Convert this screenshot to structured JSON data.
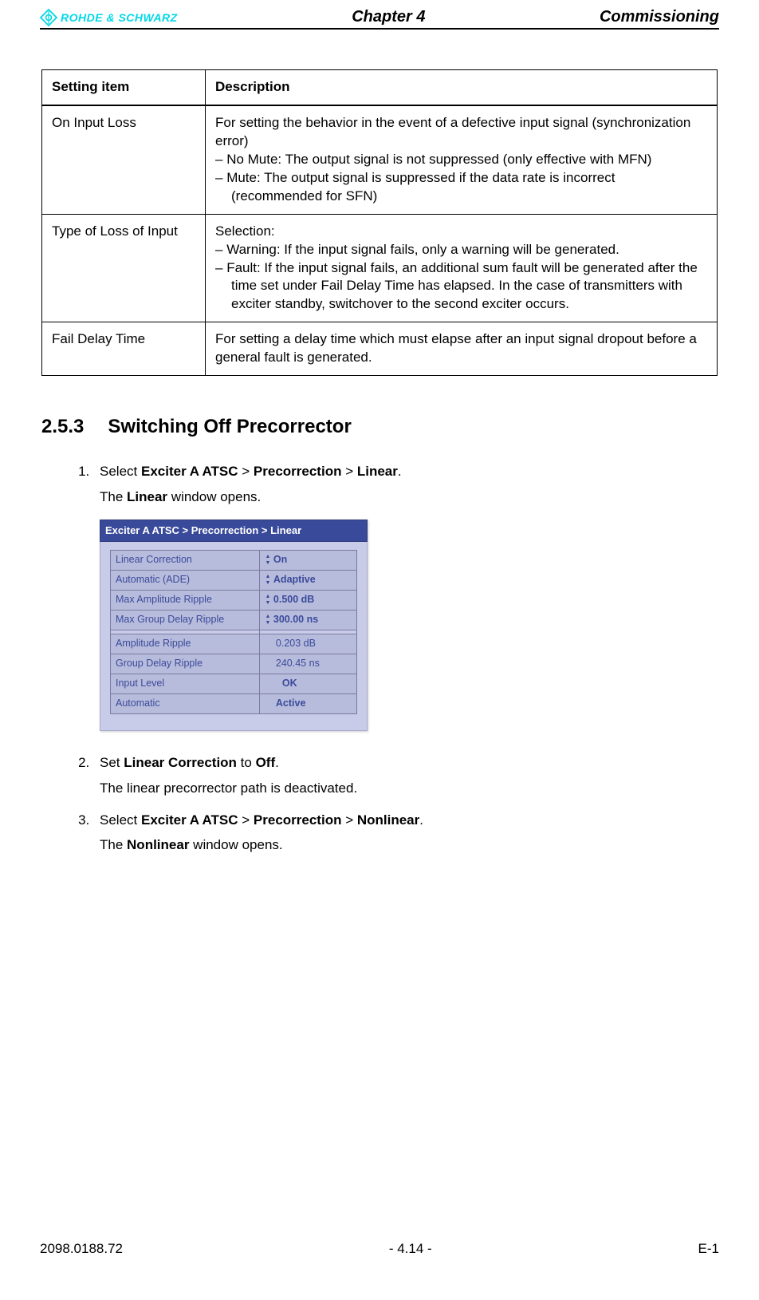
{
  "header": {
    "logo_text": "ROHDE & SCHWARZ",
    "center": "Chapter 4",
    "right": "Commissioning"
  },
  "table": {
    "head": {
      "c1": "Setting item",
      "c2": "Description"
    },
    "rows": [
      {
        "item": "On Input Loss",
        "desc_intro": "For setting the behavior in the event of a defective input signal (synchronization error)",
        "bullets": [
          "No Mute: The output signal is not suppressed (only effective with MFN)",
          "Mute: The output signal is suppressed if the data rate is incorrect (recommended for SFN)"
        ]
      },
      {
        "item": "Type of Loss of Input",
        "desc_intro": "Selection:",
        "bullets": [
          "Warning: If the input signal fails, only a warning will be generated.",
          "Fault: If the input signal fails, an additional sum fault will be generated after the time set under Fail Delay Time has elapsed. In the case of transmitters with exciter standby, switchover to the second exciter occurs."
        ]
      },
      {
        "item": "Fail Delay Time",
        "desc_intro": "For setting a delay time which must elapse after an input signal dropout before a general fault is generated.",
        "bullets": []
      }
    ]
  },
  "section": {
    "num": "2.5.3",
    "title": "Switching Off Precorrector"
  },
  "steps": {
    "s1": {
      "pre": "Select ",
      "b1": "Exciter A ATSC",
      "gt1": " > ",
      "b2": "Precorrection",
      "gt2": " > ",
      "b3": "Linear",
      "post": ".",
      "line2a": "The ",
      "line2b": "Linear",
      "line2c": " window opens."
    },
    "s2": {
      "pre": "Set ",
      "b1": "Linear Correction",
      "mid": " to ",
      "b2": "Off",
      "post": ".",
      "line2": "The linear precorrector path is deactivated."
    },
    "s3": {
      "pre": "Select ",
      "b1": "Exciter A ATSC",
      "gt1": " > ",
      "b2": "Precorrection",
      "gt2": " > ",
      "b3": "Nonlinear",
      "post": ".",
      "line2a": "The ",
      "line2b": "Nonlinear",
      "line2c": " window opens."
    }
  },
  "ui": {
    "title": "Exciter A ATSC  > Precorrection > Linear",
    "rows": [
      {
        "label": "Linear Correction",
        "value": "On",
        "spin": true,
        "bold": true
      },
      {
        "label": "Automatic (ADE)",
        "value": "Adaptive",
        "spin": true,
        "bold": true
      },
      {
        "label": "Max Amplitude Ripple",
        "value": "0.500   dB",
        "spin": true,
        "bold": true
      },
      {
        "label": "Max Group Delay Ripple",
        "value": "300.00  ns",
        "spin": true,
        "bold": true
      }
    ],
    "rows2": [
      {
        "label": "Amplitude Ripple",
        "value": "0.203   dB",
        "spin": false,
        "bold": false
      },
      {
        "label": "Group Delay Ripple",
        "value": "240.45  ns",
        "spin": false,
        "bold": false
      },
      {
        "label": "Input Level",
        "value": "OK",
        "spin": false,
        "bold": true
      },
      {
        "label": "Automatic",
        "value": "Active",
        "spin": false,
        "bold": true
      }
    ]
  },
  "footer": {
    "left": "2098.0188.72",
    "center": "- 4.14 -",
    "right": "E-1"
  }
}
